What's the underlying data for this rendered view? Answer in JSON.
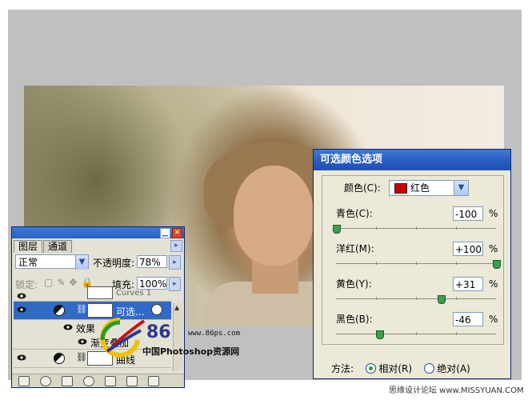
{
  "dialog": {
    "title": "可选颜色选项",
    "colors_label": "颜色(C):",
    "colors_value": "红色",
    "color_swatch": "#cc0000",
    "sliders": [
      {
        "label": "青色(C):",
        "value": "-100",
        "percent": -100
      },
      {
        "label": "洋红(M):",
        "value": "+100",
        "percent": 100
      },
      {
        "label": "黄色(Y):",
        "value": "+31",
        "percent": 31
      },
      {
        "label": "黑色(B):",
        "value": "-46",
        "percent": -46
      }
    ],
    "pct_sign": "%",
    "method_label": "方法:",
    "method_relative": "相对(R)",
    "method_absolute": "绝对(A)"
  },
  "layers": {
    "tabs": [
      "图层",
      "通道"
    ],
    "blend_mode": "正常",
    "opacity_label": "不透明度:",
    "opacity_value": "78%",
    "lock_label": "锁定:",
    "fill_label": "填充:",
    "fill_value": "100%",
    "rows": [
      {
        "name": "Curves 1"
      },
      {
        "name": "可选..."
      },
      {
        "name": "效果"
      },
      {
        "name": "渐变叠加"
      },
      {
        "name": "曲线"
      }
    ]
  },
  "watermark": {
    "logo_num": "86",
    "url": "www.86ps.com",
    "cn": "中国Photoshop资源网"
  },
  "credit": "思缘设计论坛  www.MISSYUAN.COM",
  "colors": {
    "title_blue": "#2a5fc4",
    "selected_row": "#316ac5",
    "swatch_red": "#cc0000",
    "slider_thumb": "#3aa04e"
  }
}
